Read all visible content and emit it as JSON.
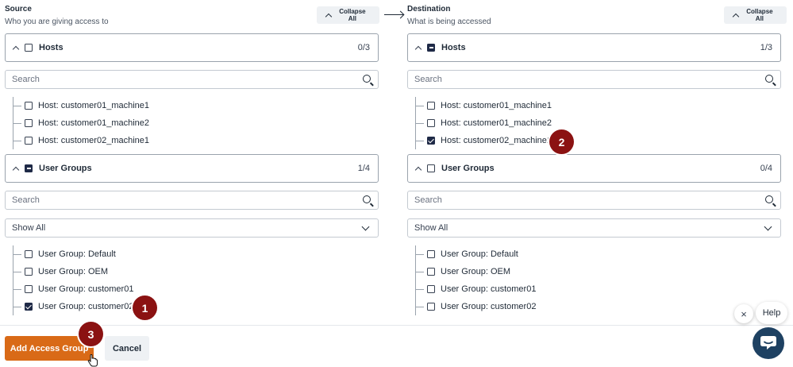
{
  "arrow_label": "",
  "footer": {
    "primary_label": "Add Access Group",
    "secondary_label": "Cancel"
  },
  "help": {
    "label": "Help",
    "close_symbol": "×"
  },
  "colors": {
    "primary": "#d96a17",
    "badge": "#8b1212",
    "chat": "#1e4162",
    "checkbox": "#1f2a47"
  },
  "icons": [
    "chevron-up-icon",
    "search-icon",
    "chevron-down-icon",
    "arrow-right-icon",
    "chat-icon",
    "close-icon",
    "hand-cursor-icon"
  ],
  "badges": [
    "1",
    "2",
    "3"
  ],
  "source": {
    "title": "Source",
    "subtitle": "Who you are giving access to",
    "collapse_label": "Collapse All",
    "hosts": {
      "label": "Hosts",
      "count": "0/3",
      "state": "unchecked",
      "search_placeholder": "Search",
      "items": [
        {
          "label": "Host: customer01_machine1",
          "checked": false
        },
        {
          "label": "Host: customer01_machine2",
          "checked": false
        },
        {
          "label": "Host: customer02_machine1",
          "checked": false
        }
      ]
    },
    "user_groups": {
      "label": "User Groups",
      "count": "1/4",
      "state": "partial",
      "search_placeholder": "Search",
      "filter_value": "Show All",
      "items": [
        {
          "label": "User Group: Default",
          "checked": false
        },
        {
          "label": "User Group: OEM",
          "checked": false
        },
        {
          "label": "User Group: customer01",
          "checked": false
        },
        {
          "label": "User Group: customer02",
          "checked": true
        }
      ]
    }
  },
  "destination": {
    "title": "Destination",
    "subtitle": "What is being accessed",
    "collapse_label": "Collapse All",
    "hosts": {
      "label": "Hosts",
      "count": "1/3",
      "state": "partial",
      "search_placeholder": "Search",
      "items": [
        {
          "label": "Host: customer01_machine1",
          "checked": false
        },
        {
          "label": "Host: customer01_machine2",
          "checked": false
        },
        {
          "label": "Host: customer02_machine1",
          "checked": true
        }
      ]
    },
    "user_groups": {
      "label": "User Groups",
      "count": "0/4",
      "state": "unchecked",
      "search_placeholder": "Search",
      "filter_value": "Show All",
      "items": [
        {
          "label": "User Group: Default",
          "checked": false
        },
        {
          "label": "User Group: OEM",
          "checked": false
        },
        {
          "label": "User Group: customer01",
          "checked": false
        },
        {
          "label": "User Group: customer02",
          "checked": false
        }
      ]
    }
  }
}
